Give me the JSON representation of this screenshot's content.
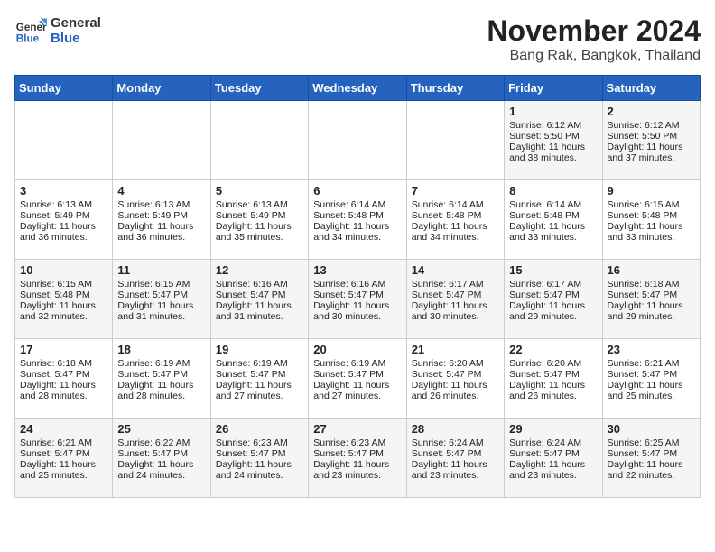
{
  "logo": {
    "line1": "General",
    "line2": "Blue"
  },
  "title": "November 2024",
  "location": "Bang Rak, Bangkok, Thailand",
  "headers": [
    "Sunday",
    "Monday",
    "Tuesday",
    "Wednesday",
    "Thursday",
    "Friday",
    "Saturday"
  ],
  "weeks": [
    [
      {
        "day": "",
        "data": ""
      },
      {
        "day": "",
        "data": ""
      },
      {
        "day": "",
        "data": ""
      },
      {
        "day": "",
        "data": ""
      },
      {
        "day": "",
        "data": ""
      },
      {
        "day": "1",
        "data": "Sunrise: 6:12 AM\nSunset: 5:50 PM\nDaylight: 11 hours and 38 minutes."
      },
      {
        "day": "2",
        "data": "Sunrise: 6:12 AM\nSunset: 5:50 PM\nDaylight: 11 hours and 37 minutes."
      }
    ],
    [
      {
        "day": "3",
        "data": "Sunrise: 6:13 AM\nSunset: 5:49 PM\nDaylight: 11 hours and 36 minutes."
      },
      {
        "day": "4",
        "data": "Sunrise: 6:13 AM\nSunset: 5:49 PM\nDaylight: 11 hours and 36 minutes."
      },
      {
        "day": "5",
        "data": "Sunrise: 6:13 AM\nSunset: 5:49 PM\nDaylight: 11 hours and 35 minutes."
      },
      {
        "day": "6",
        "data": "Sunrise: 6:14 AM\nSunset: 5:48 PM\nDaylight: 11 hours and 34 minutes."
      },
      {
        "day": "7",
        "data": "Sunrise: 6:14 AM\nSunset: 5:48 PM\nDaylight: 11 hours and 34 minutes."
      },
      {
        "day": "8",
        "data": "Sunrise: 6:14 AM\nSunset: 5:48 PM\nDaylight: 11 hours and 33 minutes."
      },
      {
        "day": "9",
        "data": "Sunrise: 6:15 AM\nSunset: 5:48 PM\nDaylight: 11 hours and 33 minutes."
      }
    ],
    [
      {
        "day": "10",
        "data": "Sunrise: 6:15 AM\nSunset: 5:48 PM\nDaylight: 11 hours and 32 minutes."
      },
      {
        "day": "11",
        "data": "Sunrise: 6:15 AM\nSunset: 5:47 PM\nDaylight: 11 hours and 31 minutes."
      },
      {
        "day": "12",
        "data": "Sunrise: 6:16 AM\nSunset: 5:47 PM\nDaylight: 11 hours and 31 minutes."
      },
      {
        "day": "13",
        "data": "Sunrise: 6:16 AM\nSunset: 5:47 PM\nDaylight: 11 hours and 30 minutes."
      },
      {
        "day": "14",
        "data": "Sunrise: 6:17 AM\nSunset: 5:47 PM\nDaylight: 11 hours and 30 minutes."
      },
      {
        "day": "15",
        "data": "Sunrise: 6:17 AM\nSunset: 5:47 PM\nDaylight: 11 hours and 29 minutes."
      },
      {
        "day": "16",
        "data": "Sunrise: 6:18 AM\nSunset: 5:47 PM\nDaylight: 11 hours and 29 minutes."
      }
    ],
    [
      {
        "day": "17",
        "data": "Sunrise: 6:18 AM\nSunset: 5:47 PM\nDaylight: 11 hours and 28 minutes."
      },
      {
        "day": "18",
        "data": "Sunrise: 6:19 AM\nSunset: 5:47 PM\nDaylight: 11 hours and 28 minutes."
      },
      {
        "day": "19",
        "data": "Sunrise: 6:19 AM\nSunset: 5:47 PM\nDaylight: 11 hours and 27 minutes."
      },
      {
        "day": "20",
        "data": "Sunrise: 6:19 AM\nSunset: 5:47 PM\nDaylight: 11 hours and 27 minutes."
      },
      {
        "day": "21",
        "data": "Sunrise: 6:20 AM\nSunset: 5:47 PM\nDaylight: 11 hours and 26 minutes."
      },
      {
        "day": "22",
        "data": "Sunrise: 6:20 AM\nSunset: 5:47 PM\nDaylight: 11 hours and 26 minutes."
      },
      {
        "day": "23",
        "data": "Sunrise: 6:21 AM\nSunset: 5:47 PM\nDaylight: 11 hours and 25 minutes."
      }
    ],
    [
      {
        "day": "24",
        "data": "Sunrise: 6:21 AM\nSunset: 5:47 PM\nDaylight: 11 hours and 25 minutes."
      },
      {
        "day": "25",
        "data": "Sunrise: 6:22 AM\nSunset: 5:47 PM\nDaylight: 11 hours and 24 minutes."
      },
      {
        "day": "26",
        "data": "Sunrise: 6:23 AM\nSunset: 5:47 PM\nDaylight: 11 hours and 24 minutes."
      },
      {
        "day": "27",
        "data": "Sunrise: 6:23 AM\nSunset: 5:47 PM\nDaylight: 11 hours and 23 minutes."
      },
      {
        "day": "28",
        "data": "Sunrise: 6:24 AM\nSunset: 5:47 PM\nDaylight: 11 hours and 23 minutes."
      },
      {
        "day": "29",
        "data": "Sunrise: 6:24 AM\nSunset: 5:47 PM\nDaylight: 11 hours and 23 minutes."
      },
      {
        "day": "30",
        "data": "Sunrise: 6:25 AM\nSunset: 5:47 PM\nDaylight: 11 hours and 22 minutes."
      }
    ]
  ]
}
